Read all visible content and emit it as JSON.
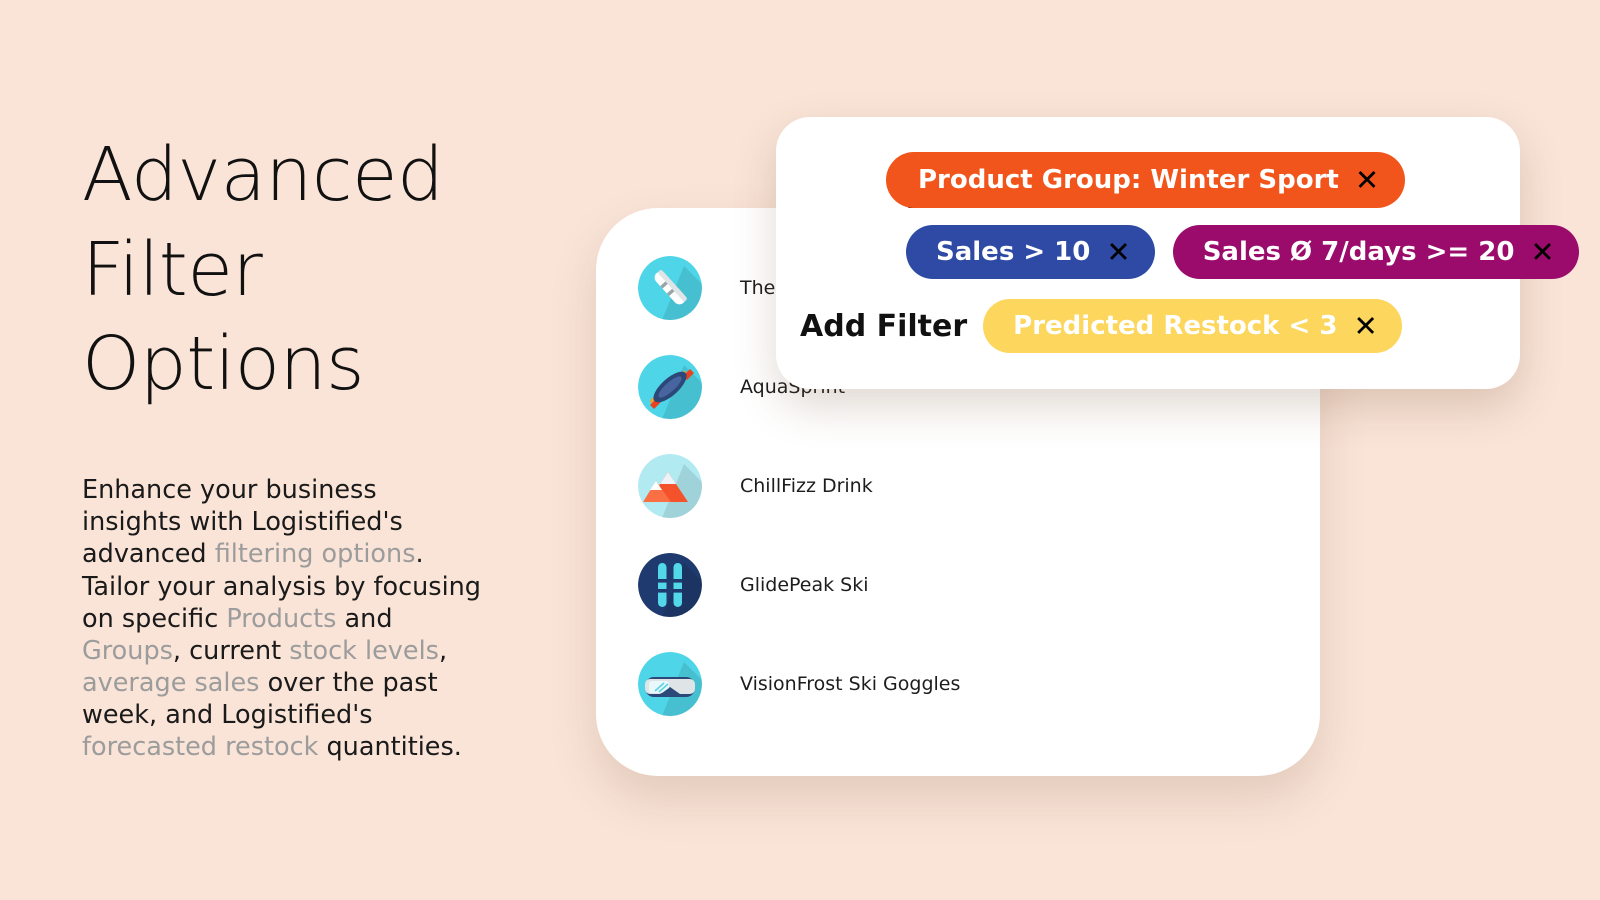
{
  "background_color": "#f9e4d7",
  "hero": {
    "headline_lines": [
      "Advanced",
      "Filter",
      "Options"
    ],
    "paragraph_parts": [
      {
        "text": "Enhance your business insights with Logistified's advanced ",
        "muted": false
      },
      {
        "text": "filtering options",
        "muted": true
      },
      {
        "text": ". Tailor your analysis by focusing on specific ",
        "muted": false
      },
      {
        "text": "Products",
        "muted": true
      },
      {
        "text": " and ",
        "muted": false
      },
      {
        "text": "Groups",
        "muted": true
      },
      {
        "text": ", current ",
        "muted": false
      },
      {
        "text": "stock levels",
        "muted": true
      },
      {
        "text": ", ",
        "muted": false
      },
      {
        "text": "average sales",
        "muted": true
      },
      {
        "text": " over the past week, and Logistified's ",
        "muted": false
      },
      {
        "text": "forecasted restock",
        "muted": true
      },
      {
        "text": " quantities.",
        "muted": false
      }
    ]
  },
  "product_list": {
    "items": [
      {
        "name": "The Min",
        "icon": "snowboard-icon",
        "circle_color": "#4ed6e8"
      },
      {
        "name": "AquaSprint",
        "icon": "kayak-icon",
        "circle_color": "#4ed6e8"
      },
      {
        "name": "ChillFizz Drink",
        "icon": "mountain-icon",
        "circle_color": "#b2eaf2"
      },
      {
        "name": "GlidePeak Ski",
        "icon": "skis-icon",
        "circle_color": "#1f3a6e"
      },
      {
        "name": "VisionFrost Ski Goggles",
        "icon": "goggles-icon",
        "circle_color": "#4ed6e8"
      }
    ]
  },
  "filter_panel": {
    "icon": "filter-icon",
    "add_filter_label": "Add Filter",
    "close_glyph": "✕",
    "chips": [
      {
        "label": "Product Group: Winter Sport",
        "color": "#f1551b"
      },
      {
        "label": "Sales > 10",
        "color": "#2e4aa5"
      },
      {
        "label": "Sales Ø 7/days >= 20",
        "color": "#9a0b6b"
      },
      {
        "label": "Predicted Restock < 3",
        "color": "#fcd65d"
      }
    ]
  }
}
